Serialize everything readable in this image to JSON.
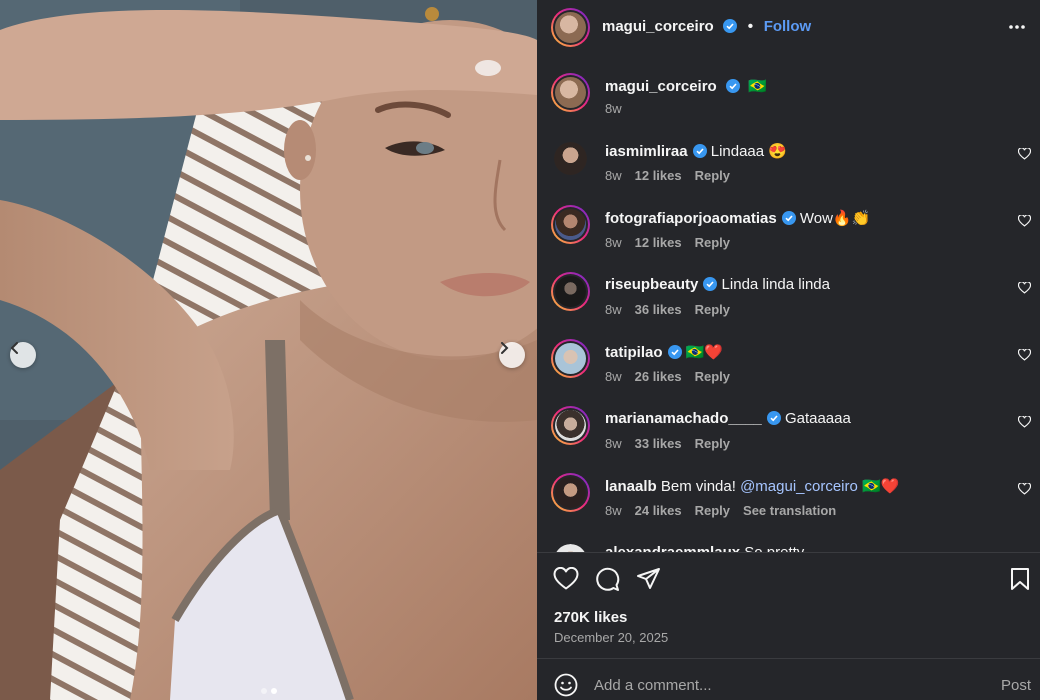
{
  "post": {
    "author": "magui_corceiro",
    "follow_label": "Follow",
    "separator": "•",
    "caption_flag": "🇧🇷",
    "caption_time": "8w",
    "likes": "270K likes",
    "date": "December 20, 2025"
  },
  "comments": [
    {
      "user": "iasmimliraa",
      "text": "Lindaaa 😍",
      "time": "8w",
      "likes": "12 likes",
      "reply": "Reply"
    },
    {
      "user": "fotografiaporjoaomatias",
      "text": "Wow🔥👏",
      "time": "8w",
      "likes": "12 likes",
      "reply": "Reply"
    },
    {
      "user": "riseupbeauty",
      "text": "Linda linda linda",
      "time": "8w",
      "likes": "36 likes",
      "reply": "Reply"
    },
    {
      "user": "tatipilao",
      "text": "🇧🇷❤️",
      "time": "8w",
      "likes": "26 likes",
      "reply": "Reply"
    },
    {
      "user": "marianamachado____",
      "text": "Gataaaaa",
      "time": "8w",
      "likes": "33 likes",
      "reply": "Reply"
    },
    {
      "user": "lanaalb",
      "text_before": "Bem vinda!",
      "mention": "@magui_corceiro",
      "text_after": "🇧🇷❤️",
      "time": "8w",
      "likes": "24 likes",
      "reply": "Reply",
      "translate": "See translation"
    },
    {
      "user": "alexandraemmlaux",
      "text": "So pretty"
    }
  ],
  "composer": {
    "placeholder": "Add a comment...",
    "post_label": "Post"
  },
  "icons": {
    "verified": "verified-badge-icon",
    "more": "more-options-icon",
    "like": "heart-icon",
    "comment": "comment-icon",
    "share": "send-icon",
    "save": "bookmark-icon",
    "emoji": "emoji-icon",
    "prev": "chevron-left-icon",
    "next": "chevron-right-icon"
  },
  "colors": {
    "panel_bg": "#25262a",
    "link_blue": "#5c9bf5",
    "verified_blue": "#3897f0",
    "muted_text": "#a8a8a8"
  }
}
